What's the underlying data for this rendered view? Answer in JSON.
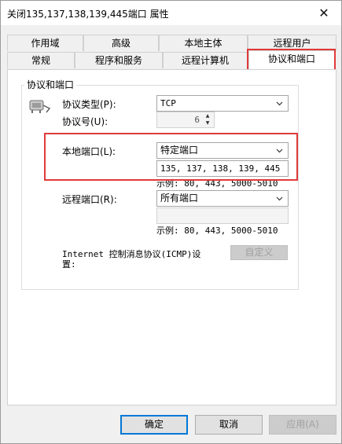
{
  "window": {
    "title": "关闭135,137,138,139,445端口 属性"
  },
  "tabs_row1": [
    "作用域",
    "高级",
    "本地主体",
    "远程用户"
  ],
  "tabs_row2": [
    "常规",
    "程序和服务",
    "远程计算机",
    "协议和端口"
  ],
  "group": {
    "title": "协议和端口",
    "protocol_type_label": "协议类型(P):",
    "protocol_type_value": "TCP",
    "protocol_number_label": "协议号(U):",
    "protocol_number_value": "6",
    "local_port_label": "本地端口(L):",
    "local_port_mode": "特定端口",
    "local_port_value": "135, 137, 138, 139, 445",
    "local_port_example": "示例: 80, 443, 5000-5010",
    "remote_port_label": "远程端口(R):",
    "remote_port_mode": "所有端口",
    "remote_port_value": "",
    "remote_port_example": "示例: 80, 443, 5000-5010",
    "icmp_label_line1": "Internet 控制消息协议(ICMP)设",
    "icmp_label_line2": "置:",
    "customize_button": "自定义"
  },
  "footer": {
    "ok": "确定",
    "cancel": "取消",
    "apply": "应用(A)"
  },
  "colors": {
    "highlight": "#e03a3a",
    "default_button_border": "#0078d7"
  }
}
